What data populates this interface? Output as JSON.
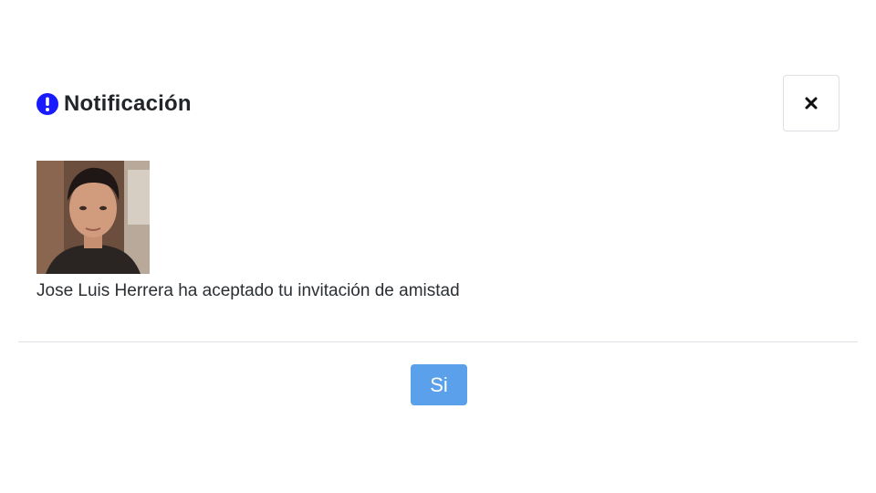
{
  "modal": {
    "title": "Notificación",
    "title_icon": "exclamation-circle-icon",
    "close_icon": "close-icon",
    "message": "Jose Luis Herrera ha aceptado tu invitación de amistad",
    "avatar_alt": "Jose Luis Herrera",
    "confirm_label": "Si"
  },
  "colors": {
    "title_icon": "#1a1aff",
    "confirm_button": "#5aa0ea",
    "divider": "#dee2e6"
  }
}
